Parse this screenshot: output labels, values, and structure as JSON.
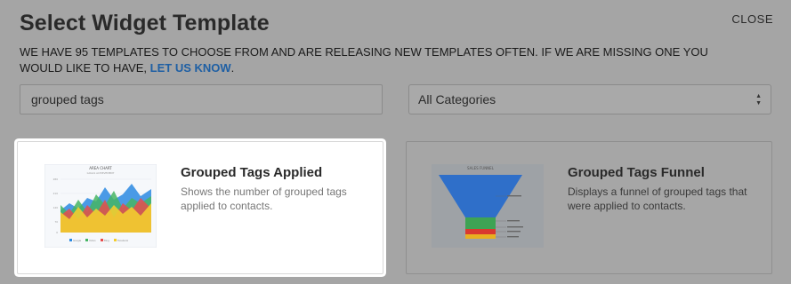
{
  "header": {
    "title": "Select Widget Template",
    "close_label": "CLOSE",
    "intro_text": "WE HAVE 95 TEMPLATES TO CHOOSE FROM AND ARE RELEASING NEW TEMPLATES OFTEN. IF WE ARE MISSING ONE YOU WOULD LIKE TO HAVE, ",
    "intro_link": "LET US KNOW",
    "intro_end": "."
  },
  "search": {
    "value": "grouped tags"
  },
  "category_select": {
    "selected": "All Categories"
  },
  "templates": [
    {
      "title": "Grouped Tags Applied",
      "description": "Shows the number of grouped tags applied to contacts.",
      "thumb": {
        "chart_title": "AREA CHART",
        "chart_subtitle": "GOALS ACHIEVEMENT",
        "y_ticks": [
          "280",
          "210",
          "140",
          "70",
          "0"
        ],
        "legend": [
          "Google",
          "Yahoo",
          "Bing",
          "Facebook"
        ],
        "legend_colors": [
          "#2b8ae2",
          "#45b563",
          "#e84c4c",
          "#f2cd2f"
        ]
      }
    },
    {
      "title": "Grouped Tags Funnel",
      "description": "Displays a funnel of grouped tags that were applied to contacts.",
      "thumb": {
        "chart_title": "SALES FUNNEL",
        "stage_colors": [
          "#2f6fc9",
          "#3ea354",
          "#d9392f",
          "#e8b021"
        ]
      }
    }
  ]
}
